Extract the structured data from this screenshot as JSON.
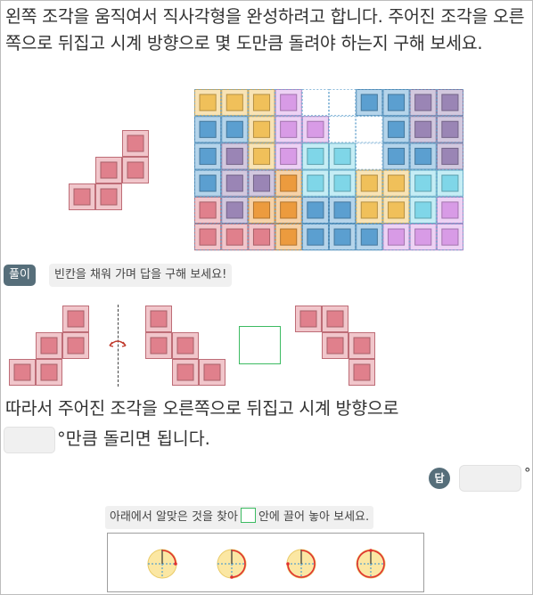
{
  "question": {
    "text": "왼쪽 조각을 움직여서 직사각형을 완성하려고 합니다. 주어진 조각을 오른쪽으로 뒤집고 시계 방향으로 몇 도만큼 돌려야 하는지 구해 보세요."
  },
  "solution": {
    "badge": "풀이",
    "hint": "빈칸을 채워 가며 답을 구해 보세요!"
  },
  "conclusion": {
    "line1": "따라서 주어진 조각을 오른쪽으로 뒤집고 시계 방향으로",
    "line2_suffix": "°만큼 돌리면 됩니다."
  },
  "answer": {
    "badge": "답",
    "unit": "°"
  },
  "drag": {
    "hint_before": "아래에서 알맞은 것을 찾아",
    "hint_after": "안에 끌어 놓아 보세요."
  },
  "choices": [
    {
      "icon": "rotate-90-icon",
      "quarters": 1
    },
    {
      "icon": "rotate-180-icon",
      "quarters": 2
    },
    {
      "icon": "rotate-270-icon",
      "quarters": 3
    },
    {
      "icon": "rotate-360-icon",
      "quarters": 4
    }
  ],
  "colors": {
    "pink": "#e0808c",
    "blue": "#5b9fd0",
    "yellow": "#f0c05a",
    "violet": "#d89be6",
    "purple": "#9a85b5",
    "cyan": "#7fd6e8",
    "orange": "#ec9b3e",
    "green": "#3dbb62",
    "badge": "#566e7a"
  },
  "puzzle": {
    "grid": [
      [
        "yellow",
        "yellow",
        "yellow",
        "violet",
        "empty",
        "empty",
        "blue",
        "blue",
        "purple",
        "purple"
      ],
      [
        "blue",
        "blue",
        "yellow",
        "violet",
        "violet",
        "empty",
        "empty",
        "blue",
        "purple",
        "purple"
      ],
      [
        "blue",
        "purple",
        "yellow",
        "violet",
        "cyan",
        "cyan",
        "empty",
        "blue",
        "blue",
        "purple"
      ],
      [
        "blue",
        "purple",
        "purple",
        "orange",
        "cyan",
        "cyan",
        "yellow",
        "yellow",
        "cyan",
        "cyan"
      ],
      [
        "pink",
        "purple",
        "orange",
        "orange",
        "blue",
        "blue",
        "yellow",
        "yellow",
        "cyan",
        "violet"
      ],
      [
        "pink",
        "pink",
        "pink",
        "orange",
        "blue",
        "blue",
        "blue",
        "violet",
        "violet",
        "violet"
      ]
    ]
  }
}
